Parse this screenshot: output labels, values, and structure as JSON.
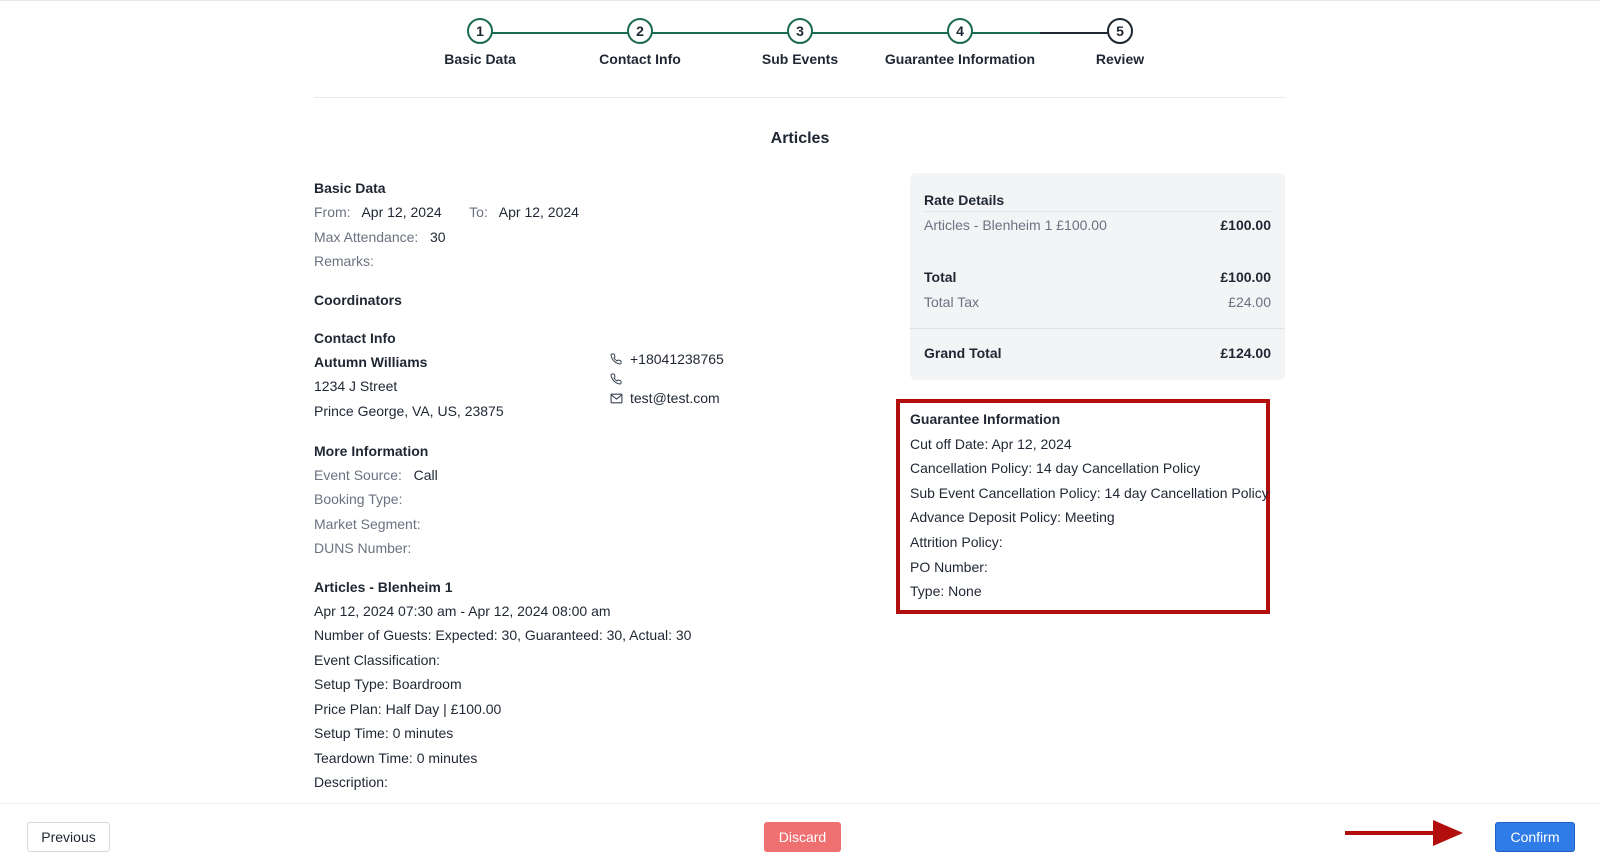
{
  "stepper": {
    "steps": [
      {
        "num": "1",
        "label": "Basic Data"
      },
      {
        "num": "2",
        "label": "Contact Info"
      },
      {
        "num": "3",
        "label": "Sub Events"
      },
      {
        "num": "4",
        "label": "Guarantee Information"
      },
      {
        "num": "5",
        "label": "Review"
      }
    ],
    "colors": {
      "complete": "#1d6b4f",
      "pending": "#1f2733"
    }
  },
  "page": {
    "title": "Articles"
  },
  "basic_data": {
    "title": "Basic Data",
    "from_label": "From:",
    "from_value": "Apr 12, 2024",
    "to_label": "To:",
    "to_value": "Apr 12, 2024",
    "max_attendance_label": "Max Attendance:",
    "max_attendance_value": "30",
    "remarks_label": "Remarks:"
  },
  "coordinators": {
    "title": "Coordinators"
  },
  "contact_info": {
    "title": "Contact Info",
    "name": "Autumn Williams",
    "street": "1234 J Street",
    "city": "Prince George, VA, US, 23875",
    "phone": "+18041238765",
    "phone2": "",
    "email": "test@test.com"
  },
  "more_info": {
    "title": "More Information",
    "event_source_label": "Event Source:",
    "event_source_value": "Call",
    "booking_type_label": "Booking Type:",
    "market_segment_label": "Market Segment:",
    "duns_label": "DUNS Number:"
  },
  "sub_event": {
    "title": "Articles - Blenheim 1",
    "time": "Apr 12, 2024 07:30 am - Apr 12, 2024 08:00 am",
    "guests": "Number of Guests: Expected: 30, Guaranteed: 30, Actual: 30",
    "classification": "Event Classification:",
    "setup_type": "Setup Type: Boardroom",
    "price_plan": "Price Plan: Half Day | £100.00",
    "setup_time": "Setup Time: 0 minutes",
    "teardown_time": "Teardown Time: 0 minutes",
    "description": "Description:"
  },
  "rate_details": {
    "title": "Rate Details",
    "item_label": "Articles - Blenheim 1 £100.00",
    "item_value": "£100.00",
    "total_label": "Total",
    "total_value": "£100.00",
    "tax_label": "Total Tax",
    "tax_value": "£24.00",
    "grand_label": "Grand Total",
    "grand_value": "£124.00"
  },
  "guarantee": {
    "title": "Guarantee Information",
    "cutoff": "Cut off Date: Apr 12, 2024",
    "cancellation": "Cancellation Policy: 14 day Cancellation Policy",
    "sub_cancellation": "Sub Event Cancellation Policy: 14 day Cancellation Policy",
    "deposit": "Advance Deposit Policy: Meeting",
    "attrition": "Attrition Policy:",
    "po": "PO Number:",
    "type": "Type: None",
    "highlight_color": "#b30e0e"
  },
  "footer": {
    "previous_label": "Previous",
    "discard_label": "Discard",
    "confirm_label": "Confirm"
  }
}
